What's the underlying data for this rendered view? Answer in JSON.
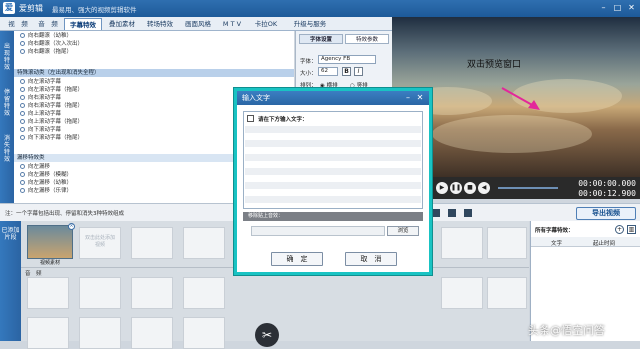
{
  "app": {
    "name": "爱剪辑",
    "subtitle": "最易用、强大的视频剪辑软件",
    "logo": "爱"
  },
  "menu": {
    "tabs": [
      "视　频",
      "音　频",
      "字幕特效",
      "叠加素材",
      "转场特效",
      "画面风格",
      "M T V",
      "卡拉OK",
      "升级与服务"
    ],
    "active": "字幕特效"
  },
  "left_tabs": [
    "出现特效",
    "停留特效",
    "消失特效"
  ],
  "effect_list": {
    "items_top": [
      "向右翻滚（幼稚）",
      "向右翻滚（次入次出）",
      "向右翻滚（拖尾）"
    ],
    "category1": "特殊滚动类（左出现和消失全程）",
    "items_mid": [
      "向左滚动字幕",
      "向左滚动字幕（拖尾）",
      "向右滚动字幕",
      "向右滚动字幕（拖尾）",
      "向上滚动字幕",
      "向上滚动字幕（拖尾）",
      "向下滚动字幕",
      "向下滚动字幕（拖尾）"
    ],
    "category2": "漏移特效类",
    "items_bottom": [
      "向左漏移",
      "向左漏移（模糊）",
      "向左漏移（幼稚）",
      "向左漏移（乐律）"
    ]
  },
  "props": {
    "tabs": [
      "字体设置",
      "特效参数"
    ],
    "font_label": "字体：",
    "font_value": "Agency FB",
    "size_label": "大小：",
    "size_value": "62",
    "align_label": "排列：",
    "align_h": "横排",
    "align_v": "竖排"
  },
  "preview": {
    "hint": "双击预览窗口"
  },
  "player": {
    "time_current": "00:00:00.000",
    "time_total": "00:00:12.900"
  },
  "notebar": {
    "text": "注：一个字幕包括出现、停留和消失3种特效组成",
    "export_label": "导出视频"
  },
  "timeline": {
    "side_label": "已添加片段",
    "clip_label": "视频素材",
    "placeholder": "双击此处添加视频",
    "audio_label": "音　频"
  },
  "subpanel": {
    "title": "所有字幕特效：",
    "col_text": "文字",
    "col_time": "起止时间"
  },
  "dialog": {
    "title": "输入文字",
    "prompt": "请在下方输入文字：",
    "position_label": "移除贴上音效：",
    "browse": "浏览",
    "ok": "确　定",
    "cancel": "取　消"
  },
  "watermark": "头条@悟空问答",
  "colors": {
    "accent": "#19c3c3",
    "brand": "#2a6fb8"
  }
}
